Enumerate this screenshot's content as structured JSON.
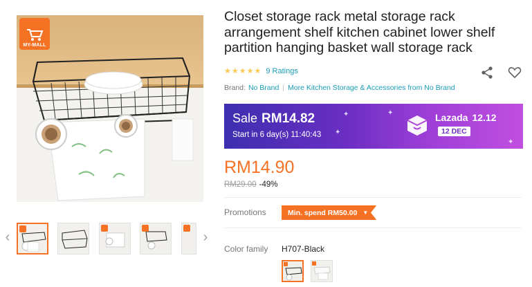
{
  "gallery": {
    "mall_badge_text": "MY-MALL",
    "prev_icon": "chevron-left-icon",
    "next_icon": "chevron-right-icon",
    "thumbnails": [
      "thumb-1",
      "thumb-2",
      "thumb-3",
      "thumb-4",
      "thumb-5"
    ]
  },
  "product": {
    "title": "Closet storage rack metal storage rack arrangement shelf kitchen cabinet lower shelf partition hanging basket wall storage rack",
    "rating_stars": 5,
    "ratings_text": "9 Ratings",
    "brand_label": "Brand:",
    "brand_name": "No Brand",
    "more_link": "More Kitchen Storage & Accessories from No Brand"
  },
  "sale_banner": {
    "sale_word": "Sale",
    "sale_price": "RM14.82",
    "start_text": "Start in 6 day(s) 11:40:43",
    "brand": "Lazada",
    "brand_date": "12.12",
    "date_badge": "12 DEC"
  },
  "pricing": {
    "price": "RM14.90",
    "original_price": "RM29.00",
    "discount": "-49%"
  },
  "promotions": {
    "label": "Promotions",
    "tag": "Min. spend RM50.00"
  },
  "color_family": {
    "label": "Color family",
    "selected_value": "H707-Black"
  },
  "colors": {
    "accent": "#f57224",
    "link": "#1a9cb7",
    "star": "#faca51"
  },
  "icons": {
    "share": "share-icon",
    "wishlist": "heart-icon"
  }
}
